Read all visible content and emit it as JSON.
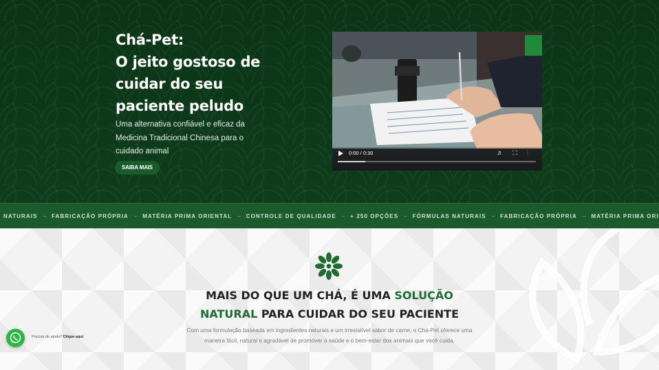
{
  "hero": {
    "title_lines": [
      "Chá-Pet:",
      "O jeito gostoso de",
      "cuidar do seu",
      "paciente peludo"
    ],
    "subtitle": "Uma alternativa confiável e eficaz da Medicina Tradicional Chinesa para o cuidado animal",
    "button_label": "SAIBA MAIS"
  },
  "video": {
    "time": "0:00 / 0:30",
    "progress": 0.14
  },
  "ticker": {
    "items": [
      "NATURAIS",
      "FABRICAÇÃO PRÓPRIA",
      "MATÉRIA PRIMA ORIENTAL",
      "CONTROLE DE QUALIDADE",
      "+ 250 OPÇÕES",
      "FÓRMULAS NATURAIS",
      "FABRICAÇÃO PRÓPRIA",
      "MATÉRIA PRIMA ORIE"
    ],
    "separator": "–"
  },
  "section": {
    "title_part1": "MAIS DO QUE UM CHÁ, É UMA ",
    "title_accent1": "SOLUÇÃO",
    "title_accent2": "NATURAL",
    "title_part2": " PARA CUIDAR DO SEU PACIENTE",
    "text": "Com uma formulação baseada em ingredientes naturais e um irresistível sabor de carne, o Chá-Pet oferece uma maneira fácil, natural e agradável de promover a saúde e o bem-estar dos animais que você cuida."
  },
  "whatsapp": {
    "prompt": "Precisa de ajuda?",
    "link": "Clique aqui"
  },
  "colors": {
    "hero_bg": "#0d3a1a",
    "accent_green": "#1f6b32",
    "ticker_bg": "#1b5b2b",
    "whatsapp": "#2cb742"
  },
  "icons": [
    "play-icon",
    "volume-icon",
    "fullscreen-icon",
    "more-icon",
    "leaf-logo-icon",
    "whatsapp-icon"
  ]
}
